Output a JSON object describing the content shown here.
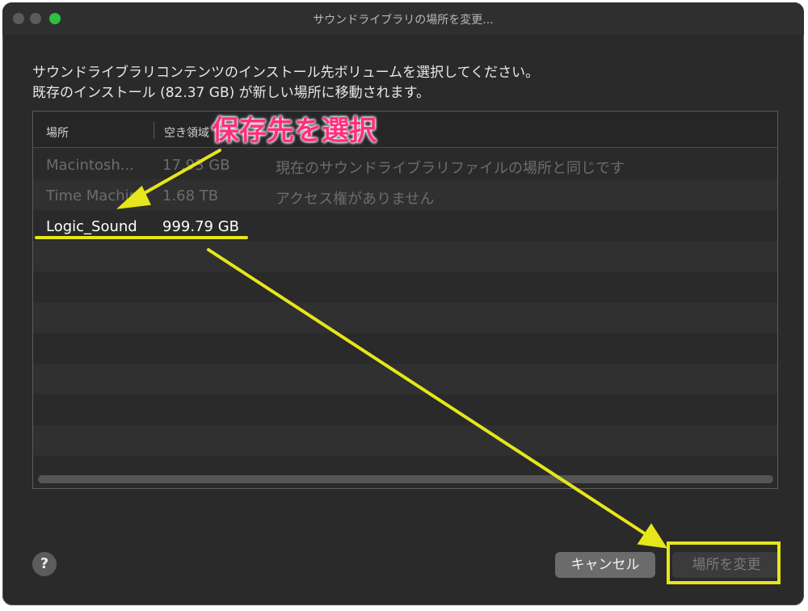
{
  "window": {
    "title": "サウンドライブラリの場所を変更..."
  },
  "message": {
    "line1": "サウンドライブラリコンテンツのインストール先ボリュームを選択してください。",
    "line2": "既存のインストール (82.37 GB) が新しい場所に移動されます。"
  },
  "table": {
    "headers": [
      "場所",
      "空き領域"
    ],
    "rows": [
      {
        "location": "Macintosh...",
        "free": "17.93 GB",
        "note": "現在のサウンドライブラリファイルの場所と同じです"
      },
      {
        "location": "Time Machine",
        "free": "1.68 TB",
        "note": "アクセス権がありません"
      },
      {
        "location": "Logic_Sound",
        "free": "999.79 GB",
        "note": ""
      }
    ]
  },
  "buttons": {
    "help": "?",
    "cancel": "キャンセル",
    "change": "場所を変更"
  },
  "annotation": {
    "label": "保存先を選択",
    "color": "#ff2f7d",
    "highlight_color": "#e6e61a"
  },
  "colors": {
    "window_bg": "#2a2a2a",
    "zoom_dot": "#2cc140"
  }
}
